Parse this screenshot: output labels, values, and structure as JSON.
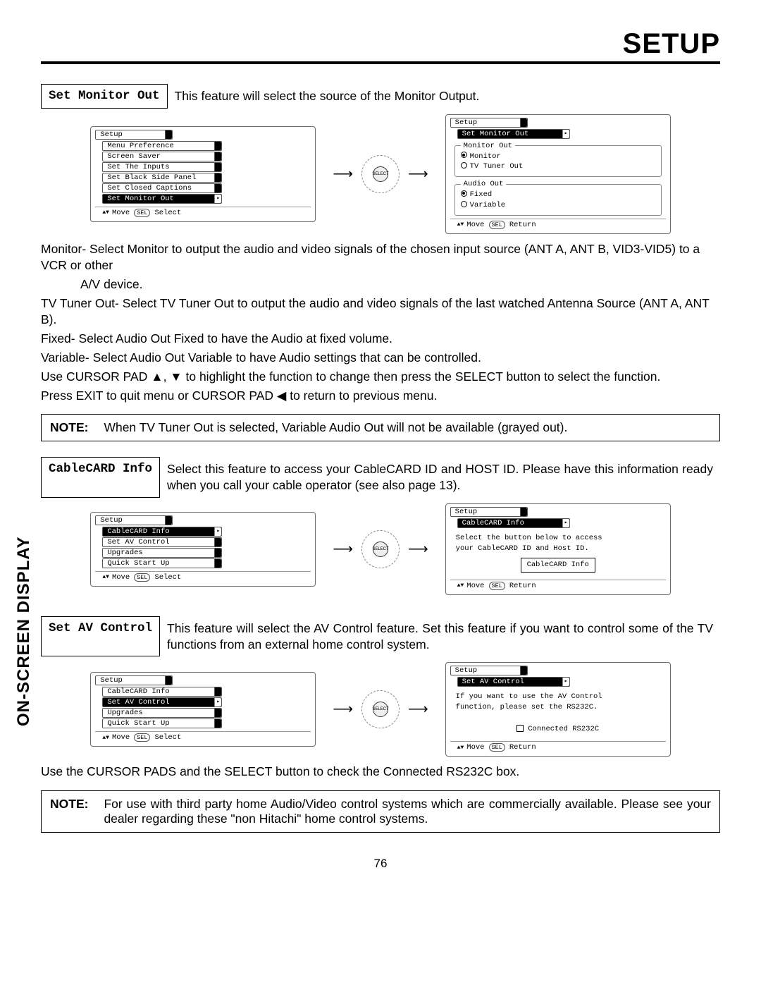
{
  "header": {
    "title": "SETUP"
  },
  "sidebar_tab": "ON-SCREEN DISPLAY",
  "page_number": "76",
  "glyphs": {
    "up": "▲",
    "down": "▼",
    "left": "◀",
    "right": "▸",
    "ud": "▲▼",
    "arrow_right_long": "⟶"
  },
  "set_monitor_out": {
    "label": "Set Monitor Out",
    "desc": "This feature will select the source of the Monitor Output.",
    "left_panel": {
      "title": "Setup",
      "items": [
        "Menu Preference",
        "Screen Saver",
        "Set The Inputs",
        "Set Black Side Panel",
        "Set Closed Captions",
        "Set Monitor Out"
      ],
      "selected_index": 5,
      "footer_prefix": "  Move ",
      "footer_sel": "SEL",
      "footer_suffix": " Select"
    },
    "right_panel": {
      "title": "Setup",
      "subtitle": "Set Monitor Out",
      "group1_label": "Monitor Out",
      "group1_opts": [
        {
          "label": "Monitor",
          "selected": true
        },
        {
          "label": "TV Tuner Out",
          "selected": false
        }
      ],
      "group2_label": "Audio Out",
      "group2_opts": [
        {
          "label": "Fixed",
          "selected": true
        },
        {
          "label": "Variable",
          "selected": false
        }
      ],
      "footer_prefix": "  Move ",
      "footer_sel": "SEL",
      "footer_suffix": " Return"
    },
    "body": {
      "l1": "Monitor- Select Monitor to output the audio and video signals of the chosen input source (ANT A, ANT B, VID3-VID5) to a VCR or other",
      "l1b": "A/V device.",
      "l2": "TV Tuner Out- Select TV Tuner Out to output the audio and video signals of the last watched Antenna Source (ANT A, ANT B).",
      "l3": "Fixed-  Select Audio Out Fixed to have the Audio at fixed volume.",
      "l4": "Variable- Select Audio Out Variable to have Audio settings that can be controlled.",
      "l5a": "Use CURSOR PAD ",
      "l5b": ", ",
      "l5c": " to highlight the function to change then press the SELECT button to select the function.",
      "l6a": "Press EXIT to quit menu or CURSOR PAD ",
      "l6b": " to return to previous menu."
    },
    "note": {
      "label": "NOTE:",
      "text": "When TV Tuner Out is selected, Variable Audio Out will not be available (grayed out)."
    }
  },
  "cablecard": {
    "label": "CableCARD Info",
    "desc": "Select this feature to access your CableCARD ID and HOST ID.  Please have this information ready when you call your cable operator (see also page 13).",
    "left_panel": {
      "title": "Setup",
      "items": [
        "CableCARD Info",
        "Set AV Control",
        "Upgrades",
        "Quick Start Up"
      ],
      "selected_index": 0,
      "footer_prefix": "  Move ",
      "footer_sel": "SEL",
      "footer_suffix": " Select"
    },
    "right_panel": {
      "title": "Setup",
      "subtitle": "CableCARD Info",
      "info1": "Select the button below to access",
      "info2": "your CableCARD ID and Host ID.",
      "button": "CableCARD Info",
      "footer_prefix": "  Move ",
      "footer_sel": "SEL",
      "footer_suffix": " Return"
    }
  },
  "set_av": {
    "label": "Set AV Control",
    "desc": "This feature will select the AV Control feature.  Set this feature if you want to control some of the TV functions from an external home control system.",
    "left_panel": {
      "title": "Setup",
      "items": [
        "CableCARD Info",
        "Set AV Control",
        "Upgrades",
        "Quick Start Up"
      ],
      "selected_index": 1,
      "footer_prefix": "  Move ",
      "footer_sel": "SEL",
      "footer_suffix": " Select"
    },
    "right_panel": {
      "title": "Setup",
      "subtitle": "Set AV Control",
      "info1": "If you want to use the AV Control",
      "info2": "function, please set the RS232C.",
      "checkbox_label": "Connected RS232C",
      "footer_prefix": "  Move ",
      "footer_sel": "SEL",
      "footer_suffix": " Return"
    },
    "body_after": "Use the CURSOR PADS and the SELECT button to check the Connected RS232C box.",
    "note": {
      "label": "NOTE:",
      "text": "For use with third party home Audio/Video control systems which are commercially available.  Please see your dealer regarding these \"non Hitachi\" home control systems."
    }
  },
  "select_wheel_label": "SELECT"
}
